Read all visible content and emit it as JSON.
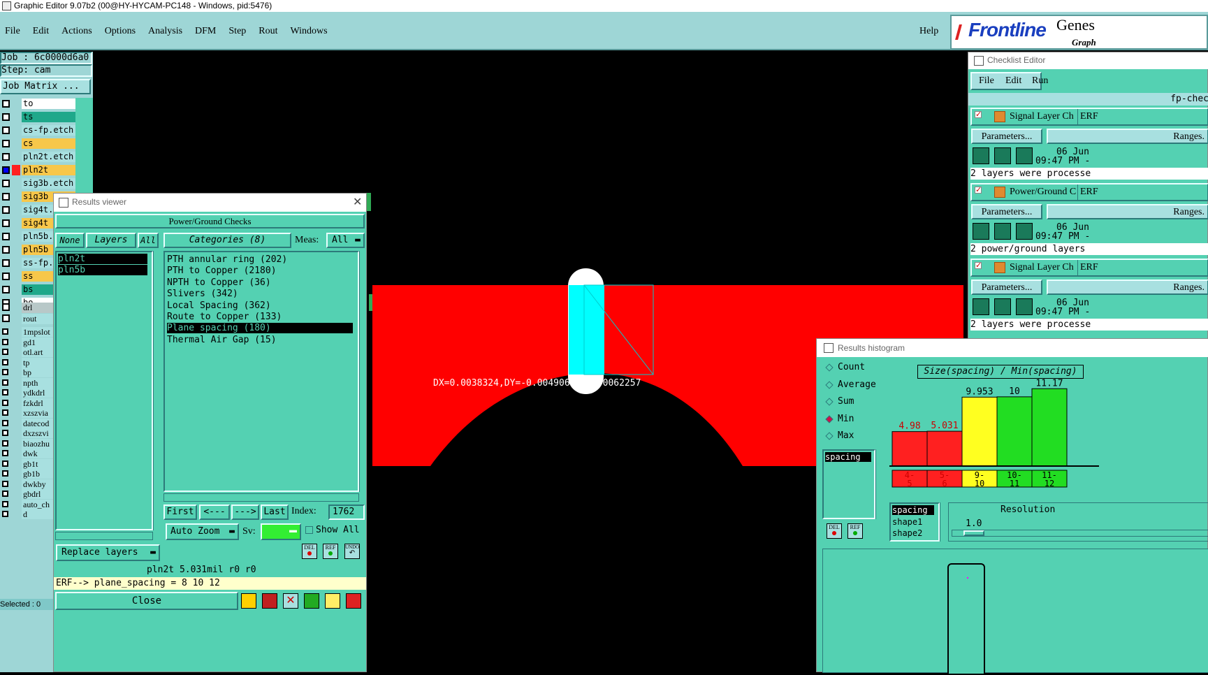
{
  "title_bar": {
    "text": "Graphic Editor 9.07b2 (00@HY-HYCAM-PC148 - Windows, pid:5476)"
  },
  "menu": {
    "items": [
      "File",
      "Edit",
      "Actions",
      "Options",
      "Analysis",
      "DFM",
      "Step",
      "Rout",
      "Windows"
    ],
    "help": "Help"
  },
  "brand": {
    "logo": "Frontline",
    "product": "Genes",
    "sub": "Graph"
  },
  "job": {
    "job_label": "Job  :  6c0000d6a0",
    "step_label": "Step:  cam",
    "matrix_button": "Job Matrix ..."
  },
  "layers": [
    {
      "name": "to",
      "color": "#ffffff"
    },
    {
      "name": "ts",
      "color": "#1fa88a"
    },
    {
      "name": "cs-fp.etch",
      "color": "#a8e0e0"
    },
    {
      "name": "cs",
      "color": "#f7c74a"
    },
    {
      "name": "pln2t.etch",
      "color": "#a8e0e0"
    },
    {
      "name": "pln2t",
      "color": "#f7c74a"
    },
    {
      "name": "sig3b.etch",
      "color": "#a8e0e0"
    },
    {
      "name": "sig3b",
      "color": "#f7c74a"
    },
    {
      "name": "sig4t.etch",
      "color": "#a8e0e0"
    },
    {
      "name": "sig4t",
      "color": "#f7c74a"
    },
    {
      "name": "pln5b.etch",
      "color": "#a8e0e0"
    },
    {
      "name": "pln5b",
      "color": "#f7c74a"
    },
    {
      "name": "ss-fp.etch",
      "color": "#a8e0e0"
    },
    {
      "name": "ss",
      "color": "#f7c74a"
    },
    {
      "name": "bs",
      "color": "#1fa88a"
    },
    {
      "name": "bo",
      "color": "#ffffff"
    }
  ],
  "drill_layers": [
    {
      "name": "drl",
      "color": "#b8c8c8"
    },
    {
      "name": "rout",
      "color": "#a8e0e0"
    }
  ],
  "small_layers": [
    "1mpslot",
    "gd1",
    "otl.art",
    "tp",
    "bp",
    "npth",
    "ydkdrl",
    "fzkdrl",
    "xzszvia",
    "datecod",
    "dxzszvi",
    "biaozhu",
    "dwk",
    "gb1t",
    "gb1b",
    "dwkby",
    "gbdrl",
    "auto_ch",
    "d"
  ],
  "selected_label": "Selected : 0",
  "canvas": {
    "measure": "DX=0.0038324,DY=-0.0049064,D=0.0062257"
  },
  "results_viewer": {
    "title": "Results viewer",
    "header": "Power/Ground Checks",
    "none_label": "None",
    "layers_label": "Layers",
    "all_label": "All",
    "layer_items": [
      "pln2t",
      "pln5b"
    ],
    "categories_label": "Categories (8)",
    "meas_label": "Meas:",
    "meas_value": "All",
    "categories": [
      "PTH annular ring (202)",
      "PTH to Copper (2180)",
      "NPTH to Copper (36)",
      "Slivers (342)",
      "Local Spacing (362)",
      "Route to Copper (133)",
      "Plane spacing (180)",
      "Thermal Air Gap (15)"
    ],
    "selected_category": 6,
    "first": "First",
    "prev": "<---",
    "next": "--->",
    "last": "Last",
    "index_label": "Index:",
    "index_value": "1762",
    "auto_zoom": "Auto Zoom",
    "sv_label": "Sv:",
    "show_all": "Show All",
    "replace_layers": "Replace layers",
    "del": "DEL",
    "ref": "REF",
    "undo": "UNDO",
    "status": "pln2t  5.031mil   r0   r0",
    "erf": "ERF--> plane_spacing = 8 10 12",
    "close": "Close"
  },
  "checklist": {
    "title": "Checklist Editor",
    "menu": [
      "File",
      "Edit",
      "Run"
    ],
    "name": "fp-chec",
    "items": [
      {
        "label": "Signal Layer Ch",
        "erf": "ERF",
        "params": "Parameters...",
        "ranges": "Ranges.",
        "date": "06 Jun",
        "time": "09:47 PM -",
        "msg": "2 layers were processe"
      },
      {
        "label": "Power/Ground C",
        "erf": "ERF",
        "params": "Parameters...",
        "ranges": "Ranges.",
        "date": "06 Jun",
        "time": "09:47 PM -",
        "msg": "2 power/ground layers"
      },
      {
        "label": "Signal Layer Ch",
        "erf": "ERF",
        "params": "Parameters...",
        "ranges": "Ranges.",
        "date": "06 Jun",
        "time": "09:47 PM -",
        "msg": "2 layers were processe"
      }
    ]
  },
  "histogram": {
    "title": "Results histogram",
    "options": [
      "Count",
      "Average",
      "Sum",
      "Min",
      "Max"
    ],
    "selected_option": 3,
    "list": [
      "spacing"
    ],
    "chart_title": "Size(spacing) / Min(spacing)",
    "del": "DEL",
    "ref": "REF",
    "attr_list": [
      "spacing",
      "shape1",
      "shape2"
    ],
    "resolution_label": "Resolution",
    "resolution_value": "1.0"
  },
  "chart_data": {
    "type": "bar",
    "title": "Size(spacing) / Min(spacing)",
    "categories": [
      "4-5",
      "5-6",
      "9-10",
      "10-11",
      "11-12"
    ],
    "values": [
      4.98,
      5.031,
      9.953,
      10,
      11.17
    ],
    "value_labels": [
      "4.98",
      "5.031",
      "9.953",
      "10",
      "11.17"
    ],
    "colors": [
      "#ff2020",
      "#ff2020",
      "#ffff20",
      "#22dd22",
      "#22dd22"
    ],
    "label_colors": [
      "#cc0000",
      "#cc0000",
      "#000000",
      "#000000",
      "#000000"
    ],
    "ylim": [
      0,
      12
    ]
  }
}
